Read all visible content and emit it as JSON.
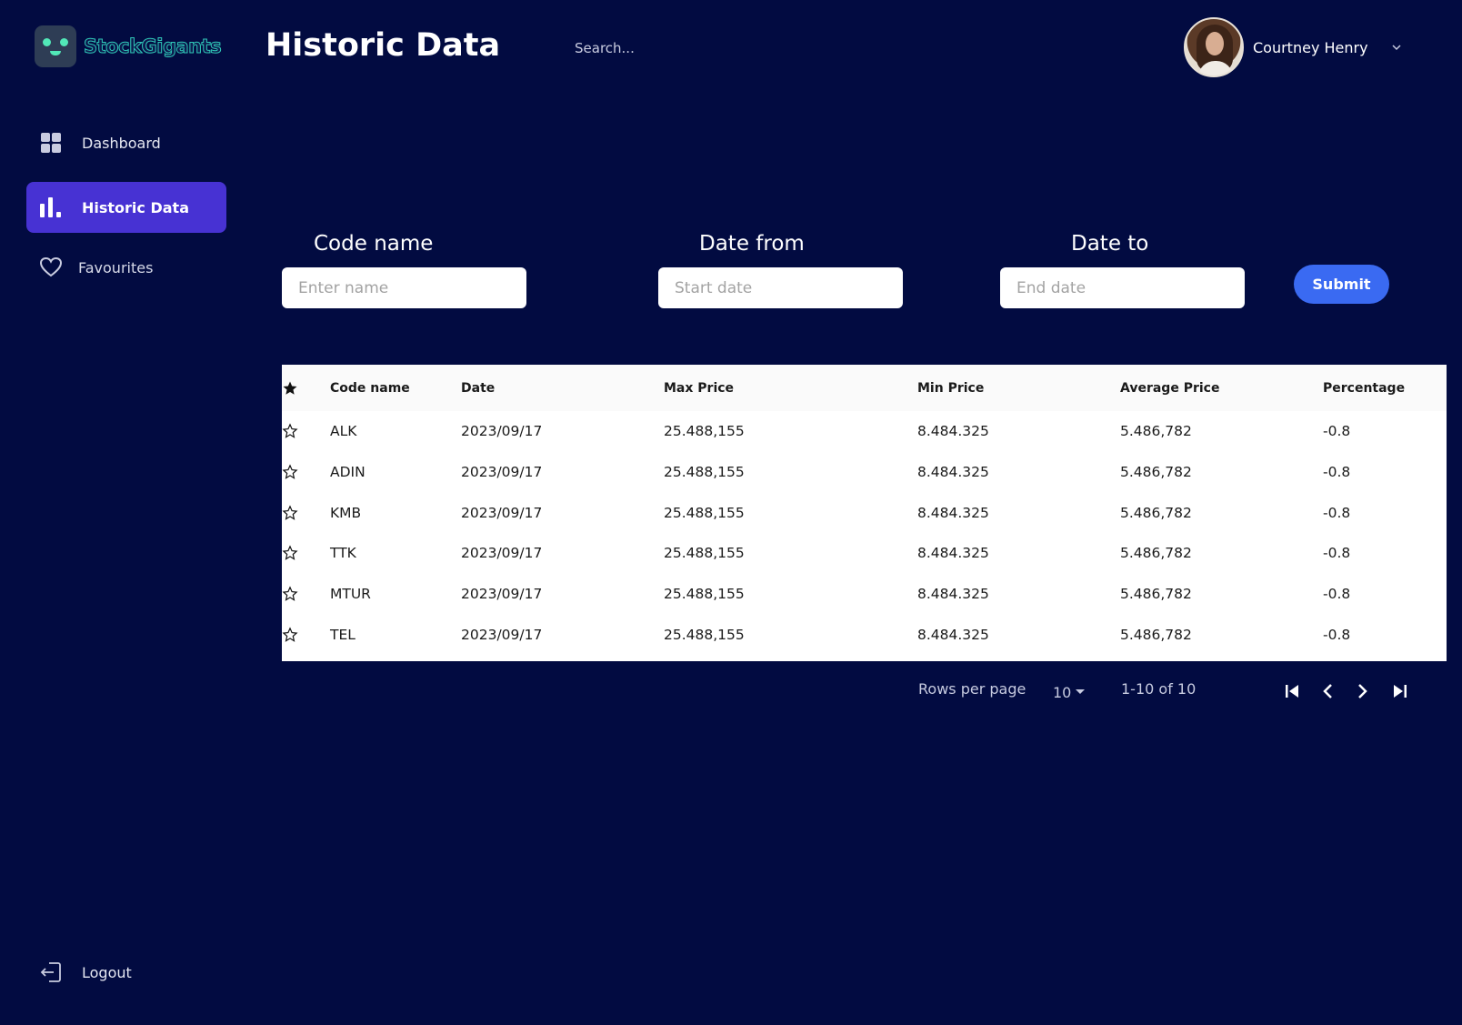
{
  "app": {
    "logo_text": "StockGigants",
    "page_title": "Historic Data",
    "search_placeholder": "Search..."
  },
  "user": {
    "name": "Courtney Henry"
  },
  "sidebar": {
    "items": [
      {
        "label": "Dashboard",
        "icon": "grid-icon"
      },
      {
        "label": "Historic Data",
        "icon": "bar-chart-icon",
        "active": true
      },
      {
        "label": "Favourites",
        "icon": "heart-icon"
      }
    ],
    "logout_label": "Logout"
  },
  "filters": {
    "code_name": {
      "label": "Code name",
      "placeholder": "Enter name"
    },
    "date_from": {
      "label": "Date from",
      "placeholder": "Start date"
    },
    "date_to": {
      "label": "Date to",
      "placeholder": "End date"
    },
    "submit_label": "Submit"
  },
  "table": {
    "columns": [
      "Code name",
      "Date",
      "Max Price",
      "Min Price",
      "Average Price",
      "Percentage"
    ],
    "rows": [
      {
        "code": "ALK",
        "date": "2023/09/17",
        "max": "25.488,155",
        "min": "8.484.325",
        "avg": "5.486,782",
        "pct": "-0.8"
      },
      {
        "code": "ADIN",
        "date": "2023/09/17",
        "max": "25.488,155",
        "min": "8.484.325",
        "avg": "5.486,782",
        "pct": "-0.8"
      },
      {
        "code": "KMB",
        "date": "2023/09/17",
        "max": "25.488,155",
        "min": "8.484.325",
        "avg": "5.486,782",
        "pct": "-0.8"
      },
      {
        "code": "TTK",
        "date": "2023/09/17",
        "max": "25.488,155",
        "min": "8.484.325",
        "avg": "5.486,782",
        "pct": "-0.8"
      },
      {
        "code": "MTUR",
        "date": "2023/09/17",
        "max": "25.488,155",
        "min": "8.484.325",
        "avg": "5.486,782",
        "pct": "-0.8"
      },
      {
        "code": "TEL",
        "date": "2023/09/17",
        "max": "25.488,155",
        "min": "8.484.325",
        "avg": "5.486,782",
        "pct": "-0.8"
      }
    ]
  },
  "pagination": {
    "rows_per_page_label": "Rows per page",
    "rows_per_page_value": "10",
    "range_text": "1-10 of 10"
  },
  "colors": {
    "background": "#020b41",
    "active_nav": "#4732d3",
    "submit_button": "#3a6af2",
    "logo_accent": "#52e8b8"
  }
}
